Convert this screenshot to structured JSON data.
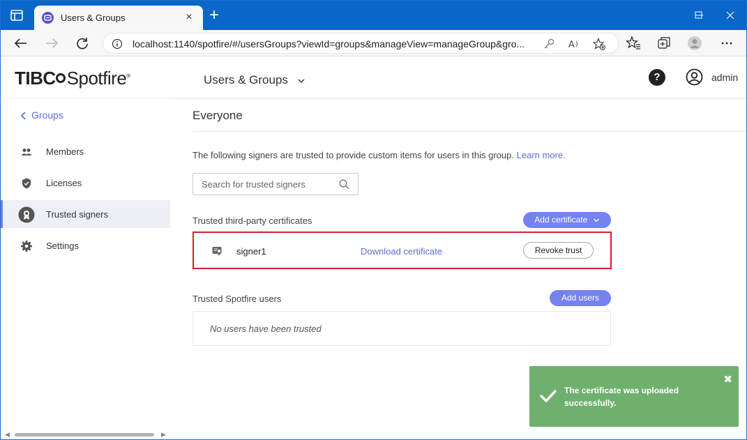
{
  "browser": {
    "tab_title": "Users & Groups",
    "url": "localhost:1140/spotfire/#/usersGroups?viewId=groups&manageView=manageGroup&gro..."
  },
  "header": {
    "logo_brand": "TIBC",
    "logo_product": "Spotfire",
    "app_title": "Users & Groups",
    "help": "?",
    "user": "admin"
  },
  "sidebar": {
    "back_label": "Groups",
    "items": [
      {
        "label": "Members",
        "icon": "members-icon"
      },
      {
        "label": "Licenses",
        "icon": "shield-icon"
      },
      {
        "label": "Trusted signers",
        "icon": "badge-icon",
        "active": true
      },
      {
        "label": "Settings",
        "icon": "gear-icon"
      }
    ]
  },
  "main": {
    "heading": "Everyone",
    "description": "The following signers are trusted to provide custom items for users in this group.",
    "learn_more": "Learn more.",
    "search_placeholder": "Search for trusted signers",
    "third_party": {
      "title": "Trusted third-party certificates",
      "add_button": "Add certificate",
      "rows": [
        {
          "name": "signer1",
          "download": "Download certificate",
          "revoke": "Revoke trust"
        }
      ]
    },
    "spotfire_users": {
      "title": "Trusted Spotfire users",
      "add_button": "Add users",
      "empty": "No users have been trusted"
    }
  },
  "toast": {
    "message": "The certificate was uploaded successfully.",
    "close": "✖"
  },
  "colors": {
    "accent": "#7582f0",
    "link": "#5b6fd6",
    "toast": "#6fb06f",
    "highlight": "#d71c2a",
    "titlebar": "#0a66c8"
  }
}
